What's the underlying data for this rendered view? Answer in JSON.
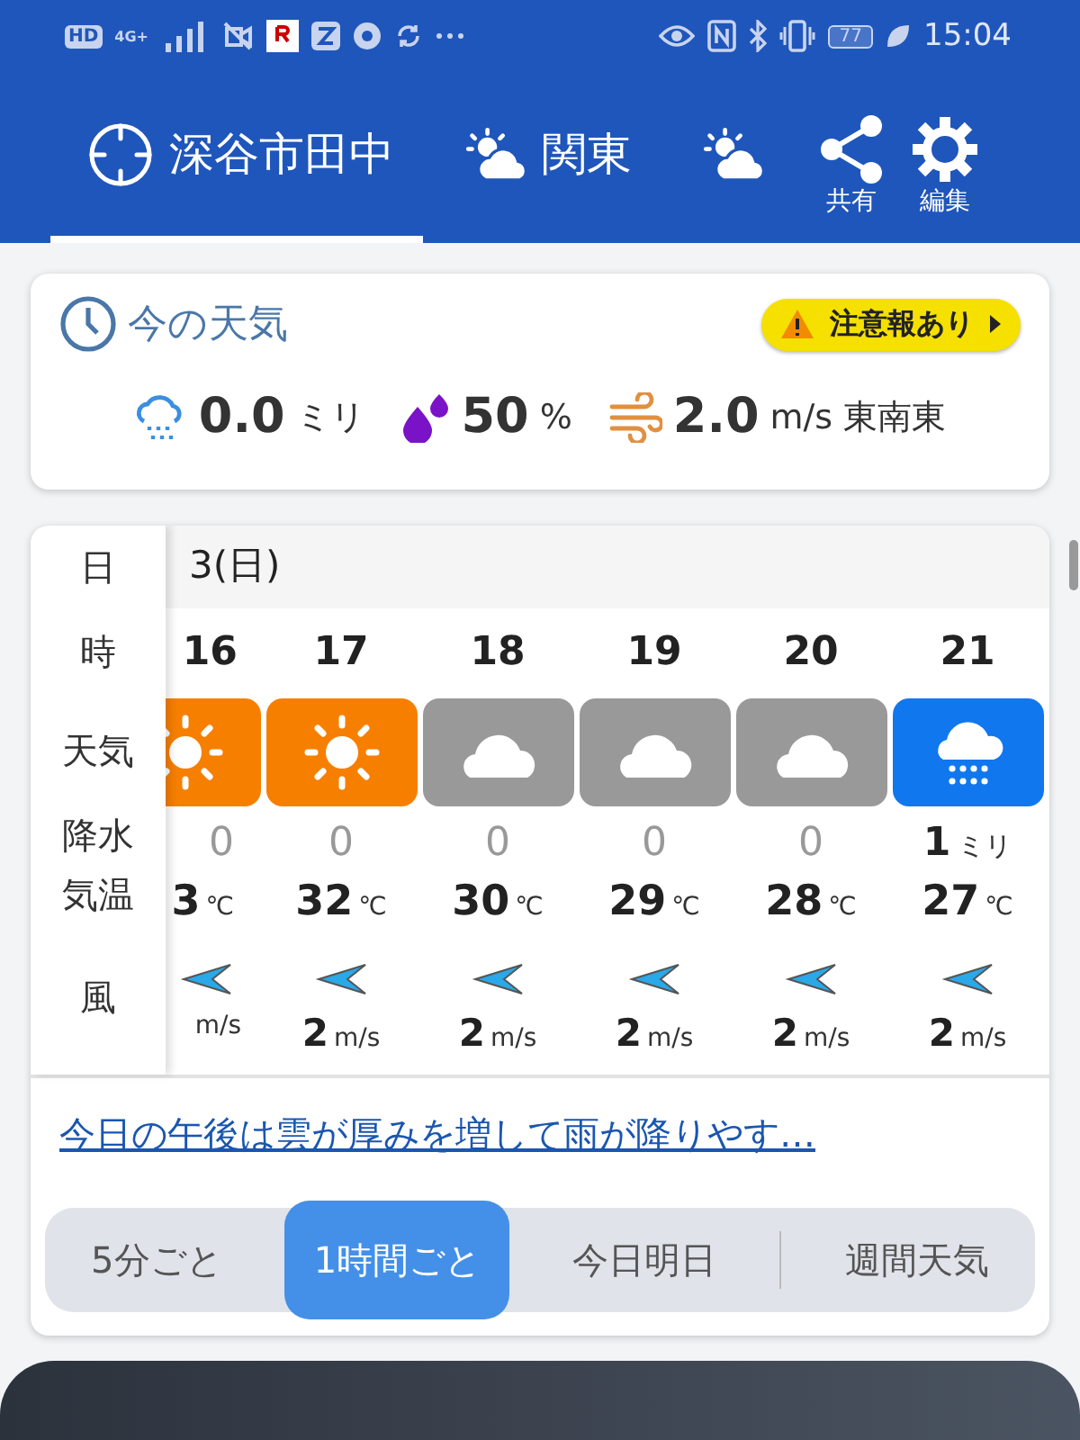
{
  "status_bar": {
    "badges": [
      "HD",
      "4G+"
    ],
    "battery": "77",
    "time": "15:04"
  },
  "header": {
    "tabs": [
      {
        "kind": "location",
        "label": "深谷市田中",
        "selected": true
      },
      {
        "kind": "region",
        "label": "関東",
        "selected": false
      },
      {
        "kind": "forecast",
        "selected": false
      }
    ],
    "actions": [
      {
        "kind": "share",
        "label": "共有"
      },
      {
        "kind": "settings",
        "label": "編集"
      }
    ]
  },
  "current": {
    "title": "今の天気",
    "alert": "注意報あり",
    "stats": [
      {
        "kind": "rain",
        "value": "0.0",
        "unit": "ミリ"
      },
      {
        "kind": "humidity",
        "value": "50",
        "unit": "%"
      },
      {
        "kind": "wind",
        "value": "2.0",
        "unit": "m/s",
        "direction": "東南東"
      }
    ]
  },
  "hourly": {
    "row_labels": [
      "日",
      "時",
      "天気",
      "降水",
      "気温",
      "風"
    ],
    "date": "3(日)",
    "hours": [
      {
        "hour": "16",
        "kind": "sunny",
        "precip": "0",
        "temp": "3",
        "temp_unit": "℃",
        "wind_unit": "m/s",
        "partial": true
      },
      {
        "hour": "17",
        "kind": "sunny",
        "precip": "0",
        "temp": "32",
        "temp_unit": "℃",
        "wind": "2",
        "wind_unit": "m/s",
        "partial": false
      },
      {
        "hour": "18",
        "kind": "cloudy",
        "precip": "0",
        "temp": "30",
        "temp_unit": "℃",
        "wind": "2",
        "wind_unit": "m/s",
        "partial": false
      },
      {
        "hour": "19",
        "kind": "cloudy",
        "precip": "0",
        "temp": "29",
        "temp_unit": "℃",
        "wind": "2",
        "wind_unit": "m/s",
        "partial": false
      },
      {
        "hour": "20",
        "kind": "cloudy",
        "precip": "0",
        "temp": "28",
        "temp_unit": "℃",
        "wind": "2",
        "wind_unit": "m/s",
        "partial": false
      },
      {
        "hour": "21",
        "kind": "rain",
        "precip": "1",
        "precip_unit": "ミリ",
        "temp": "27",
        "temp_unit": "℃",
        "wind": "2",
        "wind_unit": "m/s",
        "partial": false
      }
    ]
  },
  "summary_link": "今日の午後は雲が厚みを増して雨が降りやす…",
  "segments": [
    {
      "label": "5分ごと",
      "selected": false
    },
    {
      "label": "1時間ごと",
      "selected": true
    },
    {
      "label": "今日明日",
      "selected": false
    },
    {
      "label": "週間天気",
      "selected": false
    }
  ]
}
